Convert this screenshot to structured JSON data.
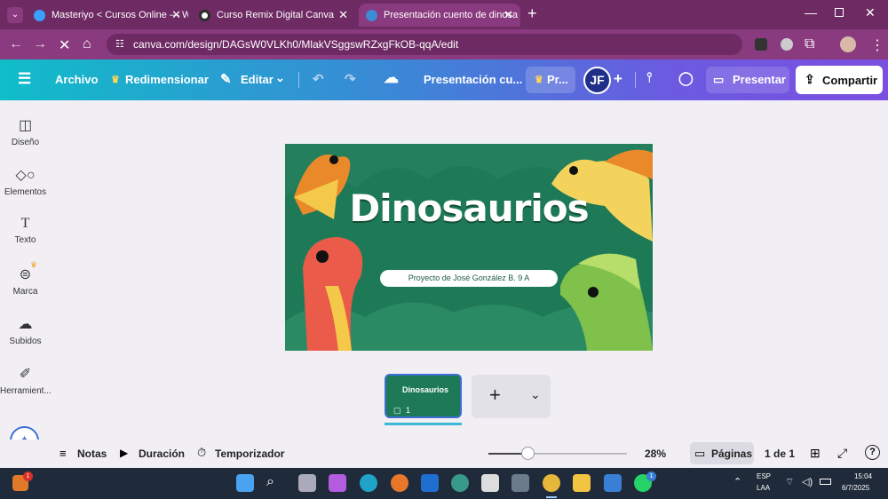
{
  "browser": {
    "tabs": [
      {
        "label": "Masteriyo < Cursos Online — W",
        "fav_color": "#3aa0ff"
      },
      {
        "label": "Curso Remix Digital Canva",
        "fav_color": "#2d2d2d"
      },
      {
        "label": "Presentación cuento de dinosa",
        "fav_color": "#3b8bd6"
      }
    ],
    "url": "canva.com/design/DAGsW0VLKh0/MlakVSggswRZxgFkOB-qqA/edit"
  },
  "toolbar": {
    "archivo": "Archivo",
    "redimensionar": "Redimensionar",
    "editar": "Editar",
    "title": "Presentación cu...",
    "pro": "Pr...",
    "avatar": "JF",
    "presentar": "Presentar",
    "compartir": "Compartir"
  },
  "sidebar": {
    "items": [
      {
        "label": "Diseño",
        "icon": "layout-icon"
      },
      {
        "label": "Elementos",
        "icon": "shapes-icon"
      },
      {
        "label": "Texto",
        "icon": "text-icon"
      },
      {
        "label": "Marca",
        "icon": "brand-icon"
      },
      {
        "label": "Subidos",
        "icon": "cloud-upload-icon"
      },
      {
        "label": "Herramient...",
        "icon": "pen-tool-icon"
      }
    ]
  },
  "slide": {
    "title": "Dinosaurios",
    "subtitle": "Proyecto de José González B.  9 A"
  },
  "pages": {
    "thumb_title": "Dinosaurios",
    "comment_count": "1"
  },
  "bottombar": {
    "notas": "Notas",
    "duracion": "Duración",
    "temporizador": "Temporizador",
    "zoom": "28%",
    "zoom_value": 0.28,
    "paginas": "Páginas",
    "page_count": "1 de 1"
  },
  "taskbar": {
    "lang1": "ESP",
    "lang2": "LAA",
    "time": "15:04",
    "date": "6/7/2025",
    "notif_count": "1",
    "whatsapp_count": "1"
  }
}
